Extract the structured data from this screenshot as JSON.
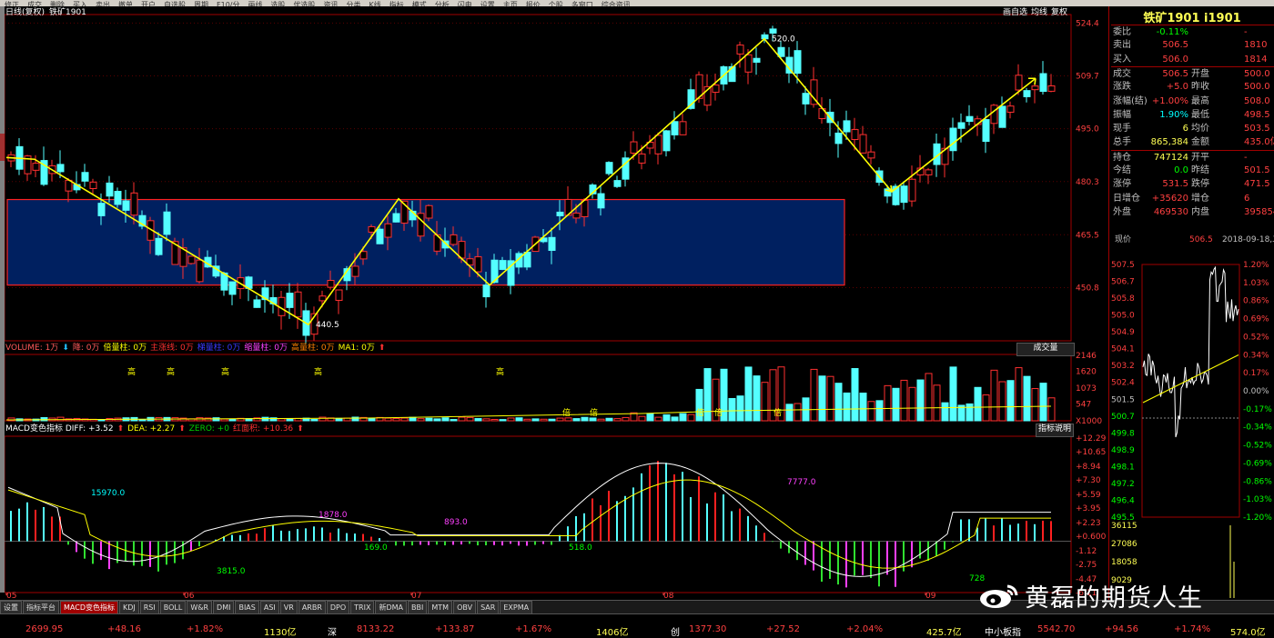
{
  "toolbar": {
    "items": [
      "修正",
      "成交",
      "删除",
      "买入",
      "卖出",
      "撤单",
      "开户",
      "自选股",
      "周期",
      "F10/分",
      "画线",
      "选股",
      "优选股",
      "资讯",
      "分类",
      "K线",
      "指标",
      "模式",
      "分析",
      "闪电",
      "设置",
      "主页",
      "报价",
      "个股",
      "多窗口",
      "综合资讯"
    ]
  },
  "chart": {
    "header": {
      "mode": "日线(复权)",
      "symbol": "铁矿1901"
    },
    "header_buttons": [
      "画自选",
      "均线",
      "复权"
    ],
    "price_scale": [
      "524.4",
      "509.7",
      "495.0",
      "480.3",
      "465.5",
      "450.8"
    ],
    "annotations": {
      "high": "520.0",
      "low": "440.5"
    },
    "volume_header": [
      {
        "t": "VOLUME: 1万",
        "c": "#ff5a5a"
      },
      {
        "t": "⬇",
        "c": "#22c0ff"
      },
      {
        "t": "降: 0万",
        "c": "#ff5a5a"
      },
      {
        "t": "倍量柱: 0万",
        "c": "#ffff00"
      },
      {
        "t": "主涨线: 0万",
        "c": "#ff3030"
      },
      {
        "t": "梯量柱: 0万",
        "c": "#3a3aff"
      },
      {
        "t": "缩量柱: 0万",
        "c": "#ff40ff"
      },
      {
        "t": "高量柱: 0万",
        "c": "#ff8000"
      },
      {
        "t": "MA1: 0万",
        "c": "#ffff00"
      },
      {
        "t": "⬆",
        "c": "#ff3030"
      }
    ],
    "volume_button": "成交量",
    "volume_scale": [
      "2146",
      "1620",
      "1073",
      "547",
      "X1000"
    ],
    "volume_marks": [
      "高",
      "高",
      "高",
      "高",
      "高",
      "倍",
      "倍",
      "倍",
      "倍",
      "倍"
    ],
    "macd_header": [
      {
        "t": "MACD变色指标 DIFF: +3.52",
        "c": "#ffffff"
      },
      {
        "t": "⬆",
        "c": "#ff3030"
      },
      {
        "t": "DEA: +2.27",
        "c": "#ffff00"
      },
      {
        "t": "⬆",
        "c": "#ff3030"
      },
      {
        "t": "ZERO: +0",
        "c": "#00d000"
      },
      {
        "t": "红面积: +10.36",
        "c": "#ff3030"
      },
      {
        "t": "⬆",
        "c": "#ff3030"
      }
    ],
    "macd_button": "指标说明",
    "macd_scale": [
      "+12.29",
      "+10.65",
      "+8.94",
      "+7.30",
      "+5.59",
      "+3.95",
      "+2.23",
      "+0.600",
      "-1.12",
      "-2.75",
      "-4.47",
      "-6.11"
    ],
    "macd_labels": [
      "15970.0",
      "1878.0",
      "893.0",
      "7777.0",
      "3815.0",
      "169.0",
      "518.0",
      "728"
    ],
    "months": [
      "05",
      "06",
      "07",
      "08",
      "09"
    ]
  },
  "chart_data": [
    {
      "type": "candlestick",
      "title": "铁矿1901 日线(复权)",
      "ylim": [
        436,
        526
      ],
      "trendline_points": [
        {
          "label": "",
          "value": 487
        },
        {
          "label": "",
          "value": 486.5
        },
        {
          "label": "440.5",
          "value": 440.5
        },
        {
          "label": "",
          "value": 475.5
        },
        {
          "label": "",
          "value": 451.5
        },
        {
          "label": "520.0",
          "value": 520.0
        },
        {
          "label": "",
          "value": 477.5
        },
        {
          "label": "",
          "value": 509
        }
      ],
      "consolidation_box": {
        "from": 475.3,
        "to": 451.5
      }
    },
    {
      "type": "bar",
      "title": "VOLUME",
      "ylim": [
        0,
        2146
      ],
      "value_unit": "X1000"
    },
    {
      "type": "bar",
      "title": "MACD变色指标",
      "series": [
        {
          "name": "DIFF",
          "last": 3.52
        },
        {
          "name": "DEA",
          "last": 2.27
        }
      ],
      "ylim": [
        -6.11,
        12.29
      ]
    }
  ],
  "quote": {
    "title": "铁矿1901 i1901",
    "rows": [
      {
        "l": "委比",
        "v": "-0.11%",
        "vc": "#00ff00",
        "l2": "",
        "v2": "-"
      },
      {
        "l": "卖出",
        "v": "506.5",
        "vc": "#ff4040",
        "l2": "",
        "v2": "1810"
      },
      {
        "l": "买入",
        "v": "506.0",
        "vc": "#ff4040",
        "l2": "",
        "v2": "1814"
      },
      {
        "l": "成交",
        "v": "506.5",
        "vc": "#ff4040",
        "l2": "开盘",
        "v2": "500.0"
      },
      {
        "l": "涨跌",
        "v": "+5.0",
        "vc": "#ff4040",
        "l2": "昨收",
        "v2": "500.0"
      },
      {
        "l": "涨幅(结)",
        "v": "+1.00%",
        "vc": "#ff4040",
        "l2": "最高",
        "v2": "508.0"
      },
      {
        "l": "振幅",
        "v": "1.90%",
        "vc": "#00ffff",
        "l2": "最低",
        "v2": "498.5"
      },
      {
        "l": "现手",
        "v": "6",
        "vc": "#ffff54",
        "l2": "均价",
        "v2": "503.5"
      },
      {
        "l": "总手",
        "v": "865,384",
        "vc": "#ffff54",
        "l2": "金额",
        "v2": "435.0亿"
      },
      {
        "l": "持仓",
        "v": "747124",
        "vc": "#ffff54",
        "l2": "开平",
        "v2": "-"
      },
      {
        "l": "今结",
        "v": "0.0",
        "vc": "#00ff00",
        "l2": "昨结",
        "v2": "501.5"
      },
      {
        "l": "涨停",
        "v": "531.5",
        "vc": "#ff4040",
        "l2": "跌停",
        "v2": "471.5"
      },
      {
        "l": "日增仓",
        "v": "+35620",
        "vc": "#ff4040",
        "l2": "增仓",
        "v2": "6"
      },
      {
        "l": "外盘",
        "v": "469530",
        "vc": "#ff4040",
        "l2": "内盘",
        "v2": "395854"
      }
    ],
    "current_label": "现价",
    "current_price": "506.5",
    "date": "2018-09-18,二",
    "price_scale": [
      "507.5",
      "506.7",
      "505.8",
      "505.0",
      "504.9",
      "504.1",
      "503.2",
      "502.4",
      "501.5",
      "500.7",
      "499.8",
      "498.9",
      "498.1",
      "497.2",
      "496.4",
      "495.5"
    ],
    "pct_scale": [
      "1.20%",
      "1.03%",
      "0.86%",
      "0.69%",
      "0.52%",
      "0.34%",
      "0.17%",
      "0.00%",
      "-0.17%",
      "-0.34%",
      "-0.52%",
      "-0.69%",
      "-0.86%",
      "-1.03%",
      "-1.20%"
    ],
    "vol_scale": [
      "36115",
      "27086",
      "18058",
      "9029"
    ]
  },
  "tabs": [
    "设置",
    "指标平台",
    "MACD变色指标",
    "KDJ",
    "RSI",
    "BOLL",
    "W&R",
    "DMI",
    "BIAS",
    "ASI",
    "VR",
    "ARBR",
    "DPO",
    "TRIX",
    "新DMA",
    "BBI",
    "MTM",
    "OBV",
    "SAR",
    "EXPMA"
  ],
  "active_tab": "MACD变色指标",
  "status": [
    {
      "t": "2699.95",
      "c": "#ff4040"
    },
    {
      "t": "+48.16",
      "c": "#ff4040"
    },
    {
      "t": "+1.82%",
      "c": "#ff4040"
    },
    {
      "t": "1130亿",
      "c": "#ffff54"
    },
    {
      "t": "深",
      "c": "#ffffff"
    },
    {
      "t": "8133.22",
      "c": "#ff4040"
    },
    {
      "t": "+133.87",
      "c": "#ff4040"
    },
    {
      "t": "+1.67%",
      "c": "#ff4040"
    },
    {
      "t": "1406亿",
      "c": "#ffff54"
    },
    {
      "t": "创",
      "c": "#ffffff"
    },
    {
      "t": "1377.30",
      "c": "#ff4040"
    },
    {
      "t": "+27.52",
      "c": "#ff4040"
    },
    {
      "t": "+2.04%",
      "c": "#ff4040"
    },
    {
      "t": "425.7亿",
      "c": "#ffff54"
    },
    {
      "t": "中小板指",
      "c": "#ffffff"
    },
    {
      "t": "5542.70",
      "c": "#ff4040"
    },
    {
      "t": "+94.56",
      "c": "#ff4040"
    },
    {
      "t": "+1.74%",
      "c": "#ff4040"
    },
    {
      "t": "574.0亿",
      "c": "#ffff54"
    }
  ],
  "watermark": "黄磊的期货人生"
}
